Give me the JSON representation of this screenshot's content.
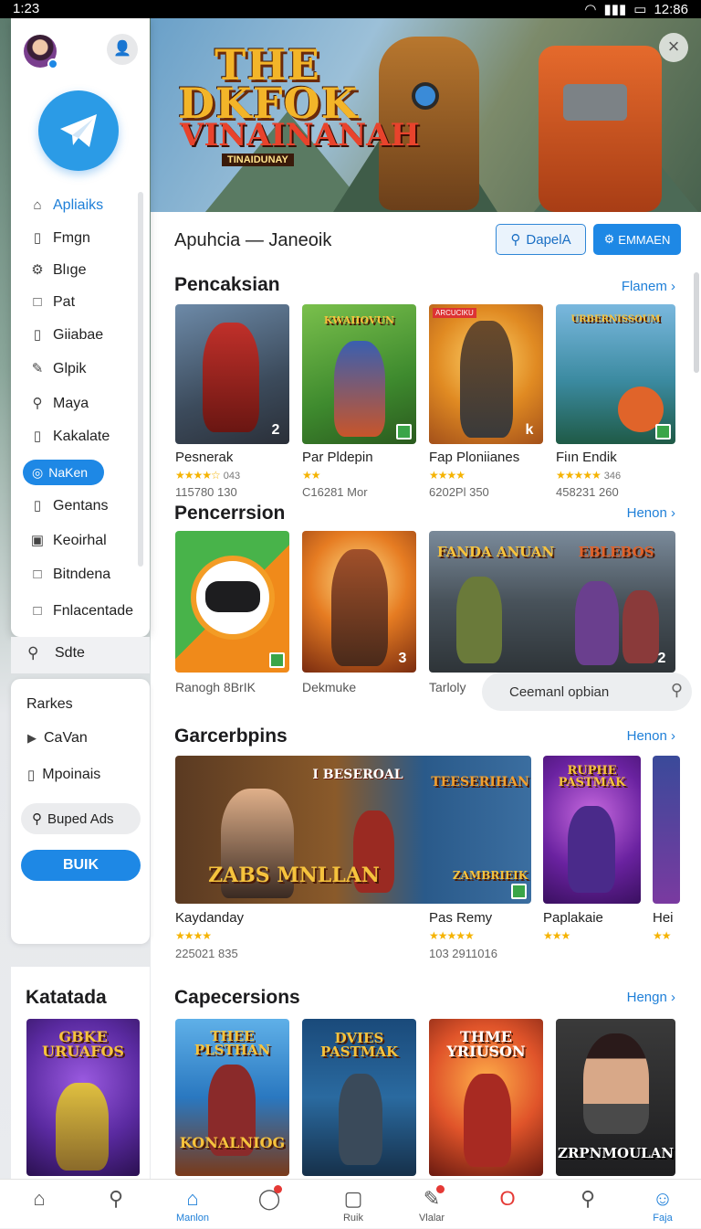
{
  "status": {
    "time_left": "1:23",
    "time_right": "12:86"
  },
  "hero": {
    "title_line1": "THE",
    "title_line2": "DKFOK",
    "subtitle": "VINAINANAH",
    "tagline": "TINAIDUNAY"
  },
  "header": {
    "title": "Apuhcia — Janeoik",
    "search_label": "DapelA",
    "primary_label": "EMMAEN"
  },
  "sections": [
    {
      "title": "Pencaksian",
      "more": "Flanem ›"
    },
    {
      "title": "Pencerrsion",
      "more": "Henon ›"
    },
    {
      "title": "Garcerbpins",
      "more": "Henon ›"
    },
    {
      "title": "Capecersions",
      "more": "Hengn ›"
    }
  ],
  "row1": [
    {
      "name": "Pesnerak",
      "rating": "★★★★☆",
      "count": "043",
      "meta": "115780 130",
      "badge": "2"
    },
    {
      "name": "Par Pldepin",
      "rating": "★★",
      "count": "",
      "meta": "C16281 Mor",
      "badge": "",
      "banner": "KWAIIOVUN"
    },
    {
      "name": "Fap Ploniianes",
      "rating": "★★★★",
      "count": "",
      "meta": "6202Pl 350",
      "badge": "k",
      "tag": "ARCUCIKU"
    },
    {
      "name": "Fiın Endik",
      "rating": "★★★★★",
      "count": "346",
      "meta": "458231 260",
      "badge": "",
      "banner": "URBERNISSOUM"
    }
  ],
  "row2": [
    {
      "name": "Ranogh 8BrIK",
      "badge": ""
    },
    {
      "name": "Dekmuke",
      "badge": "3"
    },
    {
      "name": "Tarloly",
      "badge": "2",
      "banner_left": "FANDA ANUAN",
      "banner_right": "EBLEBOS"
    }
  ],
  "mini_search": {
    "label": "Ceemanl opbian"
  },
  "row3": [
    {
      "name": "Kaydanday",
      "rating": "★★★★",
      "meta": "225021 835",
      "banner_top": "I BESEROAL",
      "banner_bottom": "ZABS MNLLAN"
    },
    {
      "name": "Pas Remy",
      "rating": "★★★★★",
      "meta": "103 2911016",
      "banner_top": "TEESERIHAN",
      "banner_bottom": "ZAMBRIEIK"
    },
    {
      "name": "Paplakaie",
      "rating": "★★★",
      "meta": "",
      "banner_top": "RUPHE PASTMAK"
    },
    {
      "name": "Hei",
      "rating": "★★",
      "meta": ""
    }
  ],
  "row4": [
    {
      "banner_top": "THEE PLSTHAN",
      "banner_bottom": "KONALNIOG"
    },
    {
      "banner_top": "DVIES PASTMAK"
    },
    {
      "banner_top": "THME YRIUSON"
    },
    {
      "banner_bottom": "ZRPNMOULAN"
    }
  ],
  "drawer": {
    "items": [
      {
        "label": "Apliaiks",
        "icon": "home-icon",
        "glyph": "⌂"
      },
      {
        "label": "Fmgn",
        "icon": "bookmark-icon",
        "glyph": "▯"
      },
      {
        "label": "Blıge",
        "icon": "gear-icon",
        "glyph": "⚙"
      },
      {
        "label": "Pat",
        "icon": "square-icon",
        "glyph": "□"
      },
      {
        "label": "Giiabae",
        "icon": "bookmark-icon",
        "glyph": "▯"
      },
      {
        "label": "Glpik",
        "icon": "pencil-icon",
        "glyph": "✎"
      },
      {
        "label": "Maya",
        "icon": "link-icon",
        "glyph": "⚲"
      },
      {
        "label": "Kakalate",
        "icon": "bookmark-icon",
        "glyph": "▯"
      }
    ],
    "active_pill": {
      "label": "NaKen",
      "icon": "globe-icon",
      "glyph": "◎"
    },
    "items2": [
      {
        "label": "Gentans",
        "icon": "bookmark-icon",
        "glyph": "▯"
      },
      {
        "label": "Keoirhal",
        "icon": "folder-icon",
        "glyph": "▣"
      },
      {
        "label": "Bitndena",
        "icon": "square-icon",
        "glyph": "□"
      },
      {
        "label": "Fnlacentade",
        "icon": "square-icon",
        "glyph": "□"
      }
    ]
  },
  "left_search": {
    "label": "Sdte"
  },
  "card2": {
    "title": "Rarkes",
    "items": [
      {
        "label": "CaVan",
        "icon": "video-icon",
        "glyph": "▶"
      },
      {
        "label": "Mpoinais",
        "icon": "bookmark-icon",
        "glyph": "▯"
      }
    ],
    "ads_label": "Buped Ads",
    "button_label": "BUIK"
  },
  "card3": {
    "title": "Katatada",
    "banner_top": "GBKE URUAFOS"
  },
  "bottom_nav": [
    {
      "label": "",
      "icon": "home-icon",
      "glyph": "⌂"
    },
    {
      "label": "",
      "icon": "search-icon",
      "glyph": "⚲"
    },
    {
      "label": "Manlon",
      "icon": "house-filled-icon",
      "glyph": "⌂",
      "active": true
    },
    {
      "label": "",
      "icon": "notification-icon",
      "glyph": "◯",
      "dot": true
    },
    {
      "label": "Ruik",
      "icon": "box-icon",
      "glyph": "▢"
    },
    {
      "label": "Vlalar",
      "icon": "edit-icon",
      "glyph": "✎",
      "dot": true
    },
    {
      "label": "",
      "icon": "opera-icon",
      "glyph": "O"
    },
    {
      "label": "",
      "icon": "search-zoom-icon",
      "glyph": "⚲"
    },
    {
      "label": "Faja",
      "icon": "profile-icon",
      "glyph": "☺",
      "active": true
    }
  ],
  "colors": {
    "accent": "#1e88e5",
    "link": "#1e7fd8",
    "star": "#f5b301"
  }
}
